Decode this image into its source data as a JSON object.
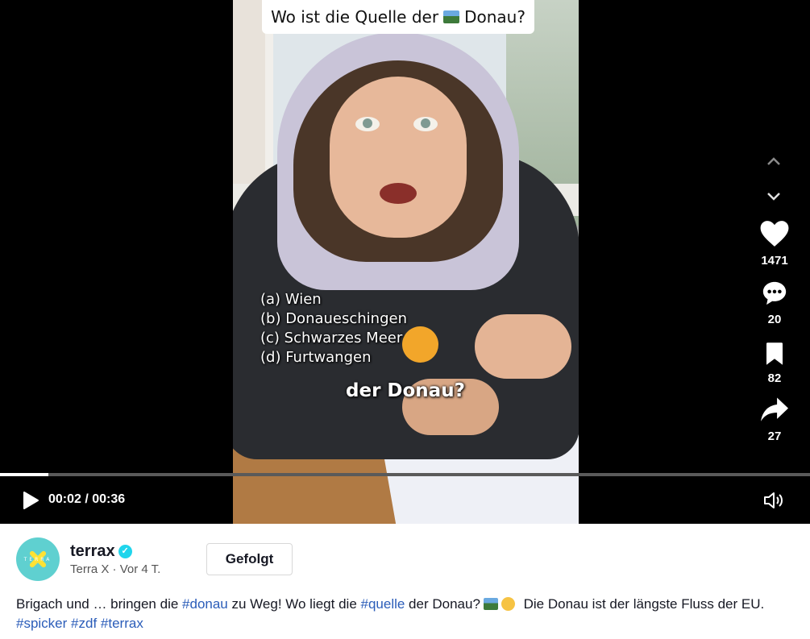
{
  "video": {
    "question": "Wo ist die Quelle der",
    "question_end": "Donau?",
    "answers": [
      "(a) Wien",
      "(b) Donaueschingen",
      "(c) Schwarzes Meer",
      "(d) Furtwangen"
    ],
    "caption": "der Donau?"
  },
  "actions": {
    "likes": "1471",
    "comments": "20",
    "saves": "82",
    "shares": "27"
  },
  "controls": {
    "time": "00:02 / 00:36",
    "progress": 0.06
  },
  "author": {
    "username": "terrax",
    "display_name": "Terra X",
    "age": "Vor 4 T.",
    "subline_sep": "·",
    "follow_label": "Gefolgt",
    "avatar_text": "TERRA"
  },
  "description": {
    "p1": "Brigach und … bringen die ",
    "tag1": "#donau",
    "p2": " zu Weg! Wo liegt die ",
    "tag2": "#quelle",
    "p3": " der Donau?",
    "p4": " Die Donau ist der längste Fluss der EU. ",
    "tag3": "#spicker",
    "tag4": "#zdf",
    "tag5": "#terrax"
  },
  "colors": {
    "accent_tag": "#2b5db9",
    "verified": "#20d5ec",
    "player_bg": "#000000"
  }
}
